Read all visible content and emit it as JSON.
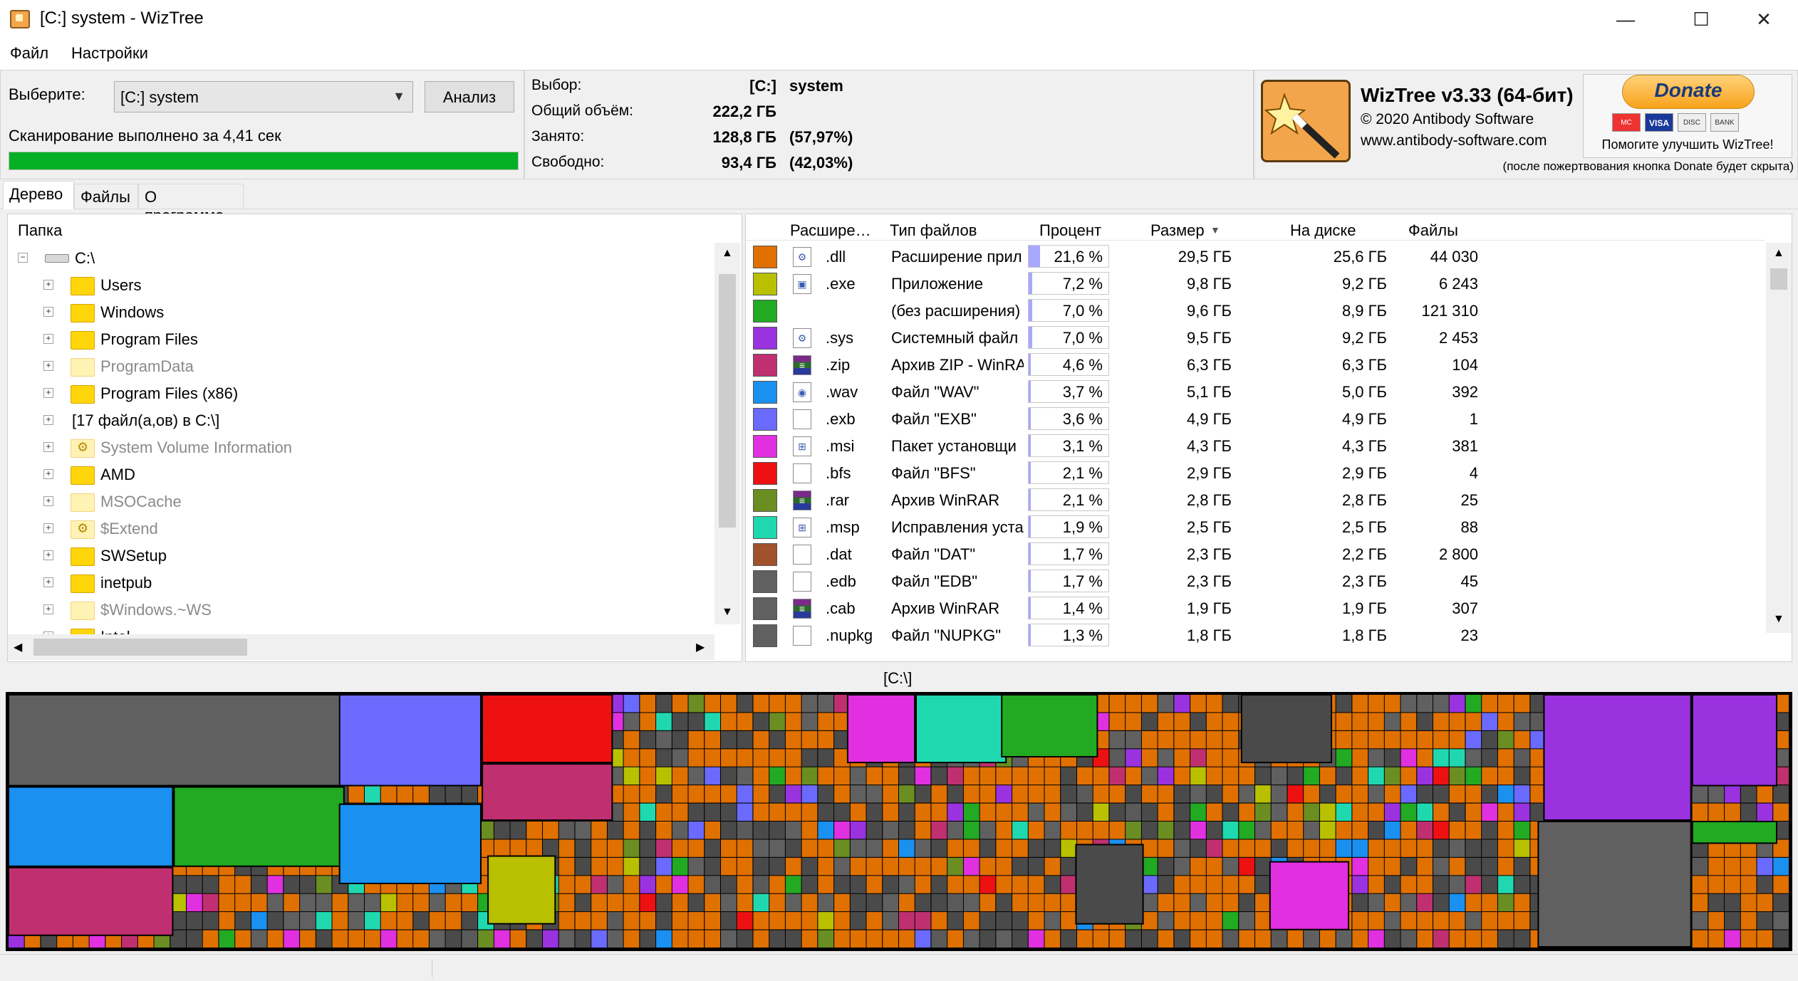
{
  "window": {
    "title": "[C:] system  - WizTree",
    "minimize": "—",
    "maximize": "☐",
    "close": "✕"
  },
  "menu": [
    "Файл",
    "Настройки"
  ],
  "scan": {
    "select_label": "Выберите:",
    "drive_value": "[C:] system",
    "analyze_button": "Анализ",
    "status": "Сканирование выполнено за 4,41 сек",
    "progress_fraction": 1.0,
    "progress_color": "#06b025"
  },
  "disk_info": {
    "selection_label": "Выбор:",
    "selection_drive": "[C:]",
    "selection_name": "system",
    "total_label": "Общий объём:",
    "total_value": "222,2 ГБ",
    "used_label": "Занято:",
    "used_value": "128,8 ГБ",
    "used_pct": "(57,97%)",
    "free_label": "Свободно:",
    "free_value": "93,4 ГБ",
    "free_pct": "(42,03%)"
  },
  "about": {
    "product": "WizTree v3.33 (64-бит)",
    "copyright": "© 2020 Antibody Software",
    "website": "www.antibody-software.com",
    "donate_button": "Donate",
    "donate_caption": "Помогите улучшить WizTree!",
    "donate_note": "(после пожертвования кнопка Donate будет скрыта)",
    "payment_icons": [
      "MC",
      "VISA",
      "DISC",
      "BANK"
    ]
  },
  "tabs": [
    {
      "label": "Дерево",
      "active": true
    },
    {
      "label": "Файлы",
      "active": false
    },
    {
      "label": "О программе",
      "active": false
    }
  ],
  "tree": {
    "header": "Папка",
    "root": "C:\\",
    "items": [
      {
        "label": "Users",
        "dim": false,
        "sys": false
      },
      {
        "label": "Windows",
        "dim": false,
        "sys": false
      },
      {
        "label": "Program Files",
        "dim": false,
        "sys": false
      },
      {
        "label": "ProgramData",
        "dim": true,
        "sys": false
      },
      {
        "label": "Program Files (x86)",
        "dim": false,
        "sys": false
      },
      {
        "label": "[17 файл(а,ов) в C:\\]",
        "dim": false,
        "sys": false,
        "nofolder": true
      },
      {
        "label": "System Volume Information",
        "dim": true,
        "sys": true
      },
      {
        "label": "AMD",
        "dim": false,
        "sys": false
      },
      {
        "label": "MSOCache",
        "dim": true,
        "sys": false
      },
      {
        "label": "$Extend",
        "dim": true,
        "sys": true
      },
      {
        "label": "SWSetup",
        "dim": false,
        "sys": false
      },
      {
        "label": "inetpub",
        "dim": false,
        "sys": false
      },
      {
        "label": "$Windows.~WS",
        "dim": true,
        "sys": false
      },
      {
        "label": "Intel",
        "dim": false,
        "sys": false
      }
    ]
  },
  "types": {
    "headers": {
      "ext": "Расшире…",
      "type": "Тип файлов",
      "percent": "Процент",
      "size": "Размер",
      "ondisk": "На диске",
      "files": "Файлы"
    },
    "rows": [
      {
        "color": "#e07000",
        "ext": ".dll",
        "type": "Расширение прил",
        "pct": "21,6 %",
        "pct_value": 21.6,
        "size": "29,5 ГБ",
        "disk": "25,6 ГБ",
        "files": "44 030",
        "icon": "gear"
      },
      {
        "color": "#b8c000",
        "ext": ".exe",
        "type": "Приложение",
        "pct": "7,2 %",
        "pct_value": 7.2,
        "size": "9,8 ГБ",
        "disk": "9,2 ГБ",
        "files": "6 243",
        "icon": "app"
      },
      {
        "color": "#22aa22",
        "ext": "",
        "type": "(без расширения)",
        "pct": "7,0 %",
        "pct_value": 7.0,
        "size": "9,6 ГБ",
        "disk": "8,9 ГБ",
        "files": "121 310",
        "icon": "none"
      },
      {
        "color": "#9a32e0",
        "ext": ".sys",
        "type": "Системный файл",
        "pct": "7,0 %",
        "pct_value": 7.0,
        "size": "9,5 ГБ",
        "disk": "9,2 ГБ",
        "files": "2 453",
        "icon": "gear"
      },
      {
        "color": "#c03070",
        "ext": ".zip",
        "type": "Архив ZIP - WinRA",
        "pct": "4,6 %",
        "pct_value": 4.6,
        "size": "6,3 ГБ",
        "disk": "6,3 ГБ",
        "files": "104",
        "icon": "rar"
      },
      {
        "color": "#1a90f0",
        "ext": ".wav",
        "type": "Файл \"WAV\"",
        "pct": "3,7 %",
        "pct_value": 3.7,
        "size": "5,1 ГБ",
        "disk": "5,0 ГБ",
        "files": "392",
        "icon": "audio"
      },
      {
        "color": "#6a6aff",
        "ext": ".exb",
        "type": "Файл \"EXB\"",
        "pct": "3,6 %",
        "pct_value": 3.6,
        "size": "4,9 ГБ",
        "disk": "4,9 ГБ",
        "files": "1",
        "icon": "blank"
      },
      {
        "color": "#e030e0",
        "ext": ".msi",
        "type": "Пакет установщи",
        "pct": "3,1 %",
        "pct_value": 3.1,
        "size": "4,3 ГБ",
        "disk": "4,3 ГБ",
        "files": "381",
        "icon": "msi"
      },
      {
        "color": "#ee1111",
        "ext": ".bfs",
        "type": "Файл \"BFS\"",
        "pct": "2,1 %",
        "pct_value": 2.1,
        "size": "2,9 ГБ",
        "disk": "2,9 ГБ",
        "files": "4",
        "icon": "blank"
      },
      {
        "color": "#6a8e22",
        "ext": ".rar",
        "type": "Архив WinRAR",
        "pct": "2,1 %",
        "pct_value": 2.1,
        "size": "2,8 ГБ",
        "disk": "2,8 ГБ",
        "files": "25",
        "icon": "rar"
      },
      {
        "color": "#20d8b0",
        "ext": ".msp",
        "type": "Исправления уста",
        "pct": "1,9 %",
        "pct_value": 1.9,
        "size": "2,5 ГБ",
        "disk": "2,5 ГБ",
        "files": "88",
        "icon": "msi"
      },
      {
        "color": "#a0522d",
        "ext": ".dat",
        "type": "Файл \"DAT\"",
        "pct": "1,7 %",
        "pct_value": 1.7,
        "size": "2,3 ГБ",
        "disk": "2,2 ГБ",
        "files": "2 800",
        "icon": "blank"
      },
      {
        "color": "#606060",
        "ext": ".edb",
        "type": "Файл \"EDB\"",
        "pct": "1,7 %",
        "pct_value": 1.7,
        "size": "2,3 ГБ",
        "disk": "2,3 ГБ",
        "files": "45",
        "icon": "blank"
      },
      {
        "color": "#606060",
        "ext": ".cab",
        "type": "Архив WinRAR",
        "pct": "1,4 %",
        "pct_value": 1.4,
        "size": "1,9 ГБ",
        "disk": "1,9 ГБ",
        "files": "307",
        "icon": "rar"
      },
      {
        "color": "#606060",
        "ext": ".nupkg",
        "type": "Файл \"NUPKG\"",
        "pct": "1,3 %",
        "pct_value": 1.3,
        "size": "1,8 ГБ",
        "disk": "1,8 ГБ",
        "files": "23",
        "icon": "blank"
      }
    ]
  },
  "treemap": {
    "label": "[C:\\]",
    "palette": [
      "#e07000",
      "#b8c000",
      "#22aa22",
      "#9a32e0",
      "#c03070",
      "#1a90f0",
      "#6a6aff",
      "#e030e0",
      "#ee1111",
      "#6a8e22",
      "#20d8b0",
      "#606060",
      "#4a4a4a",
      "#5a5a5a"
    ]
  }
}
